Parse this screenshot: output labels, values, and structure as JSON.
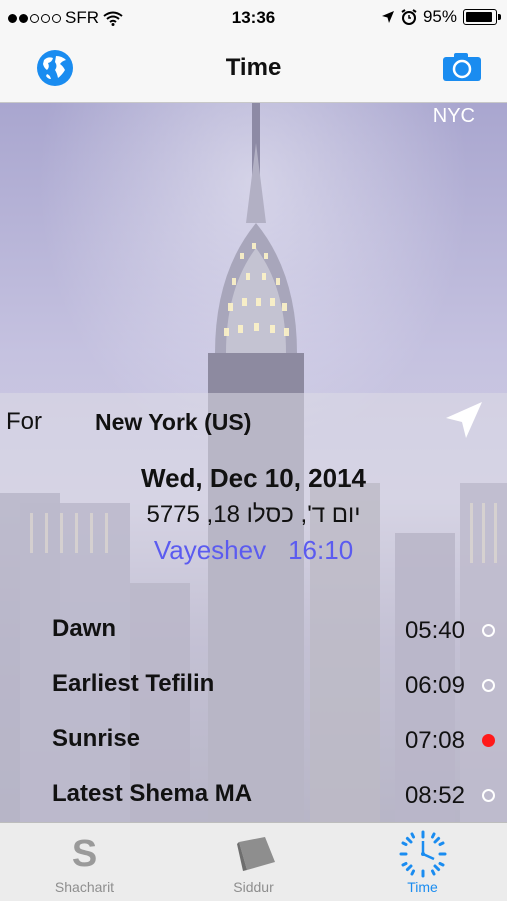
{
  "status_bar": {
    "carrier": "SFR",
    "time": "13:36",
    "battery": "95%",
    "signal_icon": "signal-dots-icon",
    "wifi_icon": "wifi-icon",
    "location_icon": "location-arrow-icon",
    "alarm_icon": "alarm-clock-icon"
  },
  "nav": {
    "title": "Time",
    "left_icon": "globe-icon",
    "right_icon": "camera-icon"
  },
  "content": {
    "city_code": "NYC",
    "for_label": "For",
    "location": "New York (US)",
    "date_gregorian": "Wed, Dec 10, 2014",
    "date_hebrew": "יום ד', כסלו 18, 5775",
    "parasha": "Vayeshev",
    "parasha_time": "16:10",
    "zmanim": [
      {
        "name": "Dawn",
        "time": "05:40",
        "active": false
      },
      {
        "name": "Earliest Tefilin",
        "time": "06:09",
        "active": false
      },
      {
        "name": "Sunrise",
        "time": "07:08",
        "active": true
      },
      {
        "name": "Latest Shema MA",
        "time": "08:52",
        "active": false
      }
    ]
  },
  "tabs": [
    {
      "label": "Shacharit",
      "icon": "shacharit-s-icon",
      "active": false
    },
    {
      "label": "Siddur",
      "icon": "book-icon",
      "active": false
    },
    {
      "label": "Time",
      "icon": "clock-icon",
      "active": true
    }
  ],
  "colors": {
    "accent": "#1a8cf0",
    "parasha": "#5b5bf0",
    "active_dot": "#ff1a1a"
  }
}
